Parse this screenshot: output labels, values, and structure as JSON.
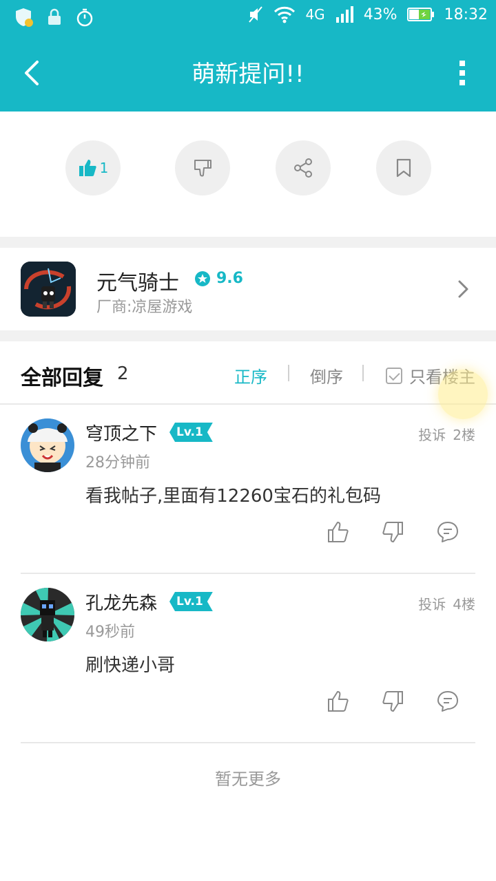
{
  "status_bar": {
    "network": "4G",
    "battery": "43%",
    "time": "18:32",
    "icons": [
      "shield-icon",
      "lock-icon",
      "timer-icon",
      "mute-icon",
      "wifi-icon",
      "signal-icon",
      "battery-charging-icon"
    ]
  },
  "header": {
    "title": "萌新提问!!"
  },
  "actions": {
    "like_count": "1",
    "icons": [
      "thumbs-up-icon",
      "thumbs-down-icon",
      "share-icon",
      "bookmark-icon"
    ]
  },
  "game": {
    "name": "元气骑士",
    "rating": "9.6",
    "vendor": "厂商:凉屋游戏"
  },
  "replies": {
    "title": "全部回复",
    "count": "2",
    "sort_forward": "正序",
    "sort_reverse": "倒序",
    "only_op": "只看楼主"
  },
  "comments": [
    {
      "user": "穹顶之下",
      "level": "Lv.1",
      "time": "28分钟前",
      "report": "投诉",
      "floor": "2楼",
      "text": "看我帖子,里面有12260宝石的礼包码"
    },
    {
      "user": "孔龙先森",
      "level": "Lv.1",
      "time": "49秒前",
      "report": "投诉",
      "floor": "4楼",
      "text": "刷快递小哥"
    }
  ],
  "footer": {
    "no_more": "暂无更多"
  },
  "colors": {
    "accent": "#17b8c6",
    "band": "#f1f1f1"
  }
}
